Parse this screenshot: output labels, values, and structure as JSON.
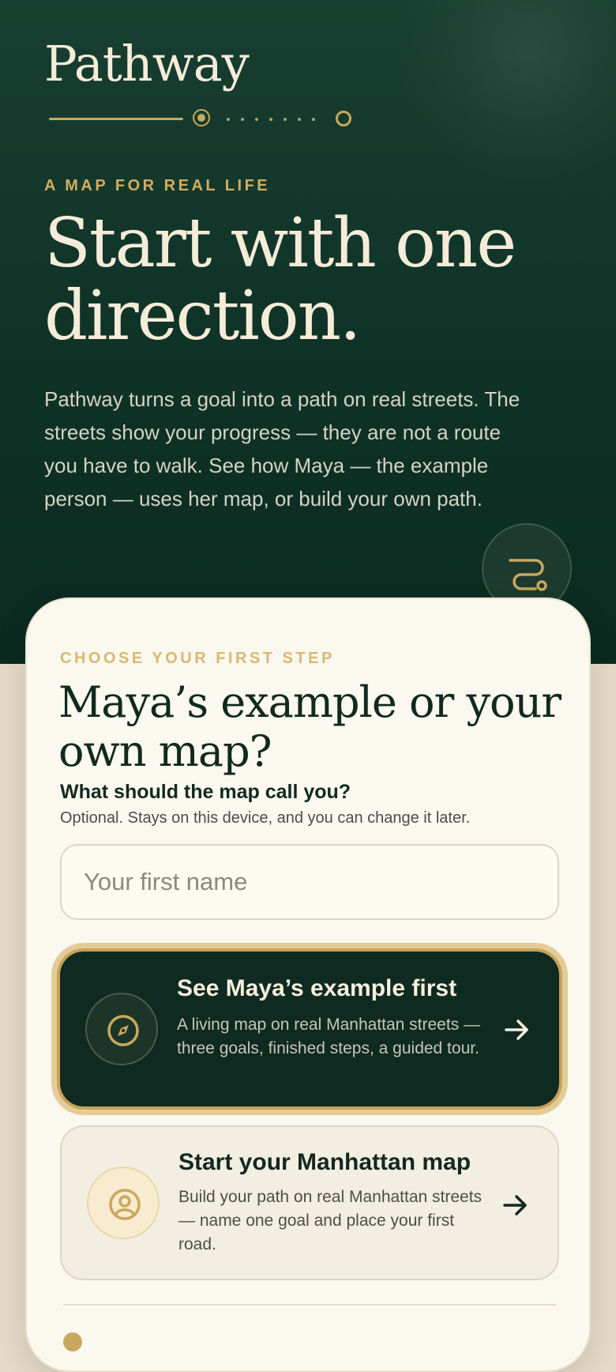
{
  "brand": {
    "name": "Pathway"
  },
  "progress": {
    "completed_fraction": 0.08,
    "total_steps": 9
  },
  "hero": {
    "eyebrow": "A MAP FOR REAL LIFE",
    "headline": "Start with one direction.",
    "intro": "Pathway turns a goal into a path on real streets. The streets show your progress — they are not a route you have to walk. See how Maya — the example person — uses her map, or build your own path.",
    "fab_icon": "route-icon"
  },
  "card": {
    "eyebrow": "CHOOSE YOUR FIRST STEP",
    "title": "Maya’s example or your own map?",
    "name_field": {
      "label": "What should the map call you?",
      "help": "Optional. Stays on this device, and you can change it later.",
      "placeholder": "Your first name",
      "value": ""
    },
    "options": [
      {
        "title": "See Maya’s example first",
        "description": "A living map on real Manhattan streets — three goals, finished steps, a guided tour.",
        "icon": "compass-icon",
        "selected": true
      },
      {
        "title": "Start your Manhattan map",
        "description": "Build your path on real Manhattan streets — name one goal and place your first road.",
        "icon": "user-icon",
        "selected": false
      }
    ]
  },
  "colors": {
    "hero_bg": "#113428",
    "gold": "#c9a85d",
    "cream": "#f4ecd9",
    "card_bg": "#fbf8ef",
    "primary_option_bg": "#0f2a21"
  }
}
